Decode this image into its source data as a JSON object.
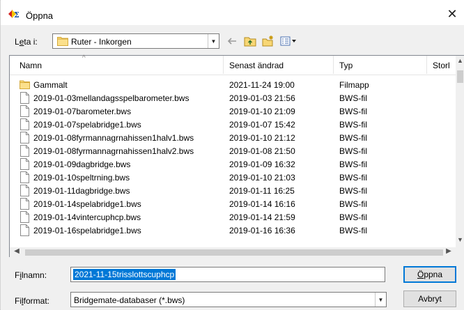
{
  "window": {
    "title": "Öppna",
    "close_glyph": "✕",
    "app_icon": "bridge-app-icon"
  },
  "location": {
    "label_prefix": "L",
    "label_underlined": "e",
    "label_suffix": "ta i:",
    "value": "Ruter - Inkorgen",
    "dropdown_glyph": "▼"
  },
  "toolbar": {
    "buttons": [
      "back-arrow-icon",
      "up-folder-icon",
      "new-folder-icon",
      "view-menu-icon"
    ]
  },
  "columns": {
    "name": "Namn",
    "modified": "Senast ändrad",
    "type": "Typ",
    "size": "Storl"
  },
  "files": [
    {
      "name": "Gammalt",
      "modified": "2021-11-24 19:00",
      "type": "Filmapp",
      "icon": "folder-icon"
    },
    {
      "name": "2019-01-03mellandagsspelbarometer.bws",
      "modified": "2019-01-03 21:56",
      "type": "BWS-fil",
      "icon": "file-icon"
    },
    {
      "name": "2019-01-07barometer.bws",
      "modified": "2019-01-10 21:09",
      "type": "BWS-fil",
      "icon": "file-icon"
    },
    {
      "name": "2019-01-07spelabridge1.bws",
      "modified": "2019-01-07 15:42",
      "type": "BWS-fil",
      "icon": "file-icon"
    },
    {
      "name": "2019-01-08fyrmannagrnahissen1halv1.bws",
      "modified": "2019-01-10 21:12",
      "type": "BWS-fil",
      "icon": "file-icon"
    },
    {
      "name": "2019-01-08fyrmannagrnahissen1halv2.bws",
      "modified": "2019-01-08 21:50",
      "type": "BWS-fil",
      "icon": "file-icon"
    },
    {
      "name": "2019-01-09dagbridge.bws",
      "modified": "2019-01-09 16:32",
      "type": "BWS-fil",
      "icon": "file-icon"
    },
    {
      "name": "2019-01-10speltrning.bws",
      "modified": "2019-01-10 21:03",
      "type": "BWS-fil",
      "icon": "file-icon"
    },
    {
      "name": "2019-01-11dagbridge.bws",
      "modified": "2019-01-11 16:25",
      "type": "BWS-fil",
      "icon": "file-icon"
    },
    {
      "name": "2019-01-14spelabridge1.bws",
      "modified": "2019-01-14 16:16",
      "type": "BWS-fil",
      "icon": "file-icon"
    },
    {
      "name": "2019-01-14vintercuphcp.bws",
      "modified": "2019-01-14 21:59",
      "type": "BWS-fil",
      "icon": "file-icon"
    },
    {
      "name": "2019-01-16spelabridge1.bws",
      "modified": "2019-01-16 16:36",
      "type": "BWS-fil",
      "icon": "file-icon"
    }
  ],
  "filename": {
    "label_prefix": "F",
    "label_underlined": "i",
    "label_suffix": "lnamn:",
    "value": "2021-11-15trisslottscuphcp"
  },
  "filetype": {
    "label_prefix": "Fi",
    "label_underlined": "l",
    "label_suffix": "format:",
    "value": "Bridgemate-databaser (*.bws)",
    "dropdown_glyph": "▼"
  },
  "buttons": {
    "open_underlined": "Ö",
    "open_rest": "ppna",
    "cancel": "Avbryt"
  },
  "scrollbars": {
    "up": "▲",
    "down": "▼",
    "left": "◀",
    "right": "▶"
  },
  "colors": {
    "selection": "#0078d7",
    "folder": "#f8d775",
    "dialog_bg": "#f0f0f0"
  }
}
